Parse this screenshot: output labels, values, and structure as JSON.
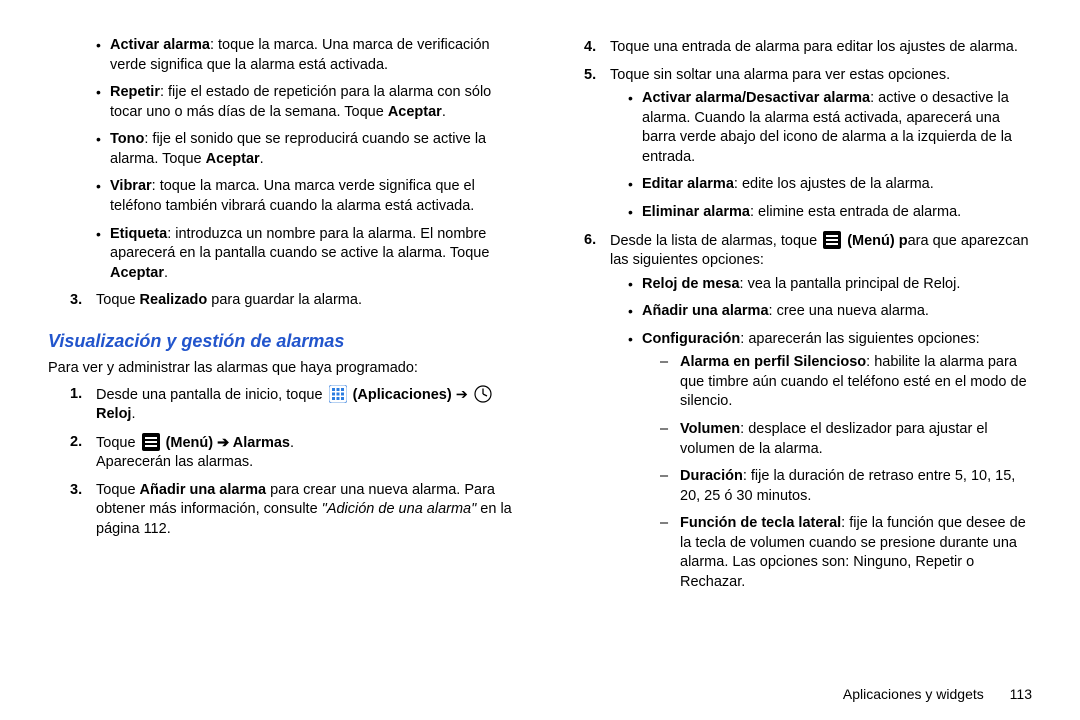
{
  "left": {
    "bullets": [
      {
        "term": "Activar alarma",
        "text": ": toque la marca. Una marca de verificación verde significa que la alarma está activada."
      },
      {
        "term": "Repetir",
        "text": ": fije el estado de repetición para la alarma con sólo tocar uno o más días de la semana. Toque ",
        "tail_bold": "Aceptar",
        "tail_after": "."
      },
      {
        "term": "Tono",
        "text": ": fije el sonido que se reproducirá cuando se active la alarma. Toque ",
        "tail_bold": "Aceptar",
        "tail_after": "."
      },
      {
        "term": "Vibrar",
        "text": ": toque la marca. Una marca verde significa que el teléfono también vibrará cuando la alarma está activada."
      },
      {
        "term": "Etiqueta",
        "text": ": introduzca un nombre para la alarma. El nombre aparecerá en la pantalla cuando se active la alarma. Toque ",
        "tail_bold": "Aceptar",
        "tail_after": "."
      }
    ],
    "step3_prefix": "Toque ",
    "step3_bold": "Realizado",
    "step3_suffix": " para guardar la alarma.",
    "section_title": "Visualización y gestión de alarmas",
    "intro": "Para ver y administrar las alarmas que haya programado:",
    "steps": {
      "s1_a": "Desde una pantalla de inicio, toque ",
      "s1_apps_bold": "(Aplicaciones)",
      "s1_arrow": " ➔ ",
      "s1_reloj_bold": "Reloj",
      "s1_end": ".",
      "s2_a": "Toque ",
      "s2_menu_bold": "(Menú)",
      "s2_arrow": " ➔ ",
      "s2_alarmas_bold": "Alarmas",
      "s2_end": ".",
      "s2_line2": "Aparecerán las alarmas.",
      "s3_a": "Toque ",
      "s3_bold": "Añadir una alarma",
      "s3_b": " para crear una nueva alarma. Para obtener más información, consulte ",
      "s3_italic": "\"Adición de una alarma\"",
      "s3_c": " en la página 112."
    }
  },
  "right": {
    "step4": "Toque una entrada de alarma para editar los ajustes de alarma.",
    "step5": "Toque sin soltar una alarma para ver estas opciones.",
    "step5_bullets": [
      {
        "term": "Activar alarma/Desactivar alarma",
        "text": ": active o desactive la alarma. Cuando la alarma está activada, aparecerá una barra verde abajo del icono de alarma a la izquierda de la entrada."
      },
      {
        "term": "Editar alarma",
        "text": ": edite los ajustes de la alarma."
      },
      {
        "term": "Eliminar alarma",
        "text": ": elimine esta entrada de alarma."
      }
    ],
    "step6_a": "Desde la lista de alarmas, toque ",
    "step6_menu_bold": "(Menú) p",
    "step6_b": "ara que aparezcan las siguientes opciones:",
    "step6_bullets": [
      {
        "term": "Reloj de mesa",
        "text": ": vea la pantalla principal de Reloj."
      },
      {
        "term": "Añadir una alarma",
        "text": ": cree una nueva alarma."
      },
      {
        "term": "Configuración",
        "text": ": aparecerán las siguientes opciones:"
      }
    ],
    "config_dashes": [
      {
        "term": "Alarma en perfil Silencioso",
        "text": ": habilite la alarma para que timbre aún cuando el teléfono esté en el modo de silencio."
      },
      {
        "term": "Volumen",
        "text": ": desplace el deslizador para ajustar el volumen de la alarma."
      },
      {
        "term": "Duración",
        "text": ": fije la duración de retraso entre 5, 10, 15, 20, 25 ó 30 minutos."
      },
      {
        "term": "Función de tecla lateral",
        "text": ": fije la función que desee de la tecla de volumen cuando se presione durante una alarma. Las opciones son: Ninguno, Repetir o Rechazar."
      }
    ],
    "footer_section": "Aplicaciones y widgets",
    "footer_page": "113"
  },
  "nums": {
    "n1": "1.",
    "n2": "2.",
    "n3": "3.",
    "n4": "4.",
    "n5": "5.",
    "n6": "6."
  }
}
